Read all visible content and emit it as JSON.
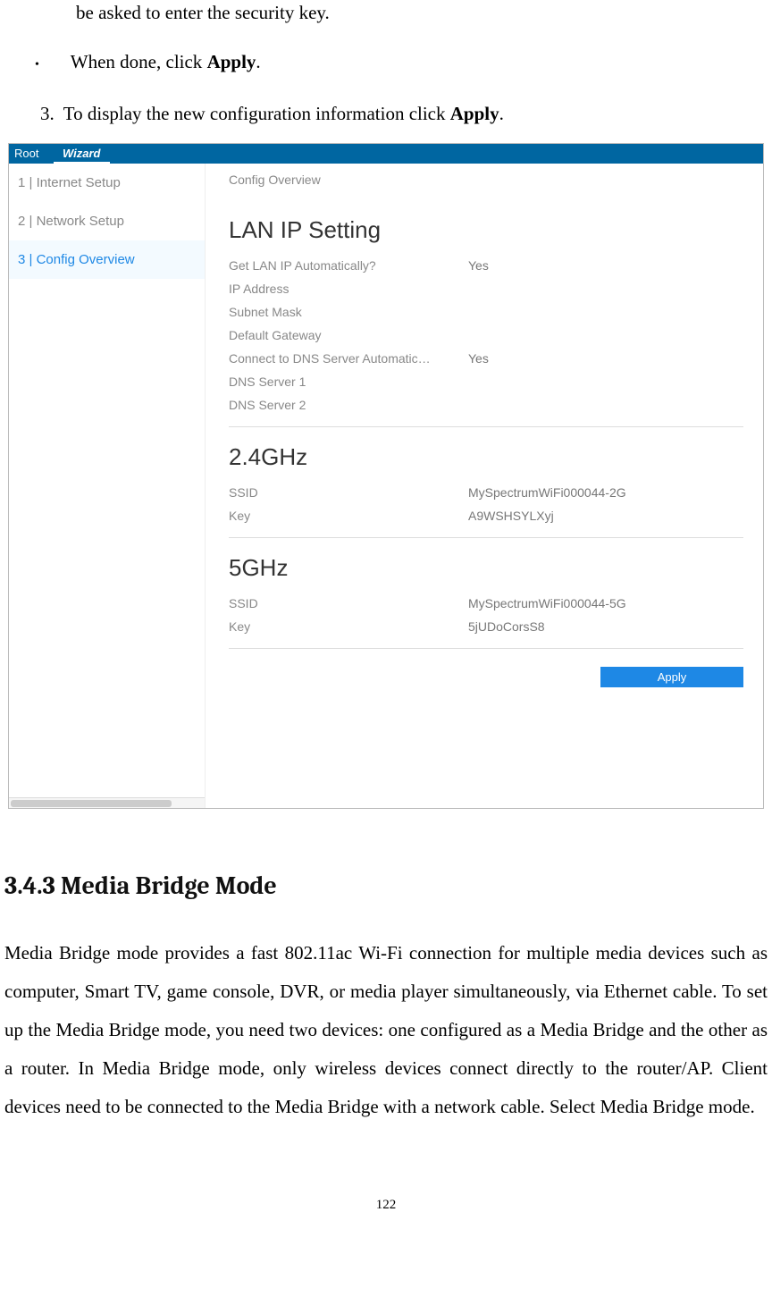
{
  "top_bullets": [
    {
      "prefix": "be asked to enter the security key.",
      "continuation": true
    },
    {
      "text_before": "When done, click ",
      "bold": "Apply",
      "text_after": "."
    }
  ],
  "num_item": {
    "marker": "3.",
    "text_before": "To display the new configuration information click ",
    "bold": "Apply",
    "text_after": "."
  },
  "screenshot": {
    "root": "Root",
    "wizard": "Wizard",
    "sidebar": [
      {
        "label": "1 | Internet Setup",
        "active": false
      },
      {
        "label": "2 | Network Setup",
        "active": false
      },
      {
        "label": "3 | Config Overview",
        "active": true
      }
    ],
    "breadcrumb": "Config Overview",
    "sections": [
      {
        "title": "LAN IP Setting",
        "rows": [
          {
            "label": "Get LAN IP Automatically?",
            "value": "Yes"
          },
          {
            "label": "IP Address",
            "value": ""
          },
          {
            "label": "Subnet Mask",
            "value": ""
          },
          {
            "label": "Default Gateway",
            "value": ""
          },
          {
            "label": "Connect to DNS Server Automatic…",
            "value": "Yes"
          },
          {
            "label": "DNS Server 1",
            "value": ""
          },
          {
            "label": "DNS Server 2",
            "value": ""
          }
        ]
      },
      {
        "title": "2.4GHz",
        "rows": [
          {
            "label": "SSID",
            "value": "MySpectrumWiFi000044-2G"
          },
          {
            "label": "Key",
            "value": "A9WSHSYLXyj"
          }
        ]
      },
      {
        "title": "5GHz",
        "rows": [
          {
            "label": "SSID",
            "value": "MySpectrumWiFi000044-5G"
          },
          {
            "label": "Key",
            "value": "5jUDoCorsS8"
          }
        ]
      }
    ],
    "apply_label": "Apply"
  },
  "section_heading": "3.4.3 Media Bridge Mode",
  "body_para": "Media Bridge mode provides a fast 802.11ac Wi-Fi connection for multiple media devices such as computer, Smart TV, game console, DVR, or media player simultaneously, via Ethernet cable. To set up the Media Bridge mode, you need two devices: one configured as a Media Bridge and the other as a router. In Media Bridge mode, only wireless devices connect directly to the router/AP. Client devices need to be connected to the Media Bridge with a network cable. Select Media Bridge mode.",
  "page_number": "122"
}
